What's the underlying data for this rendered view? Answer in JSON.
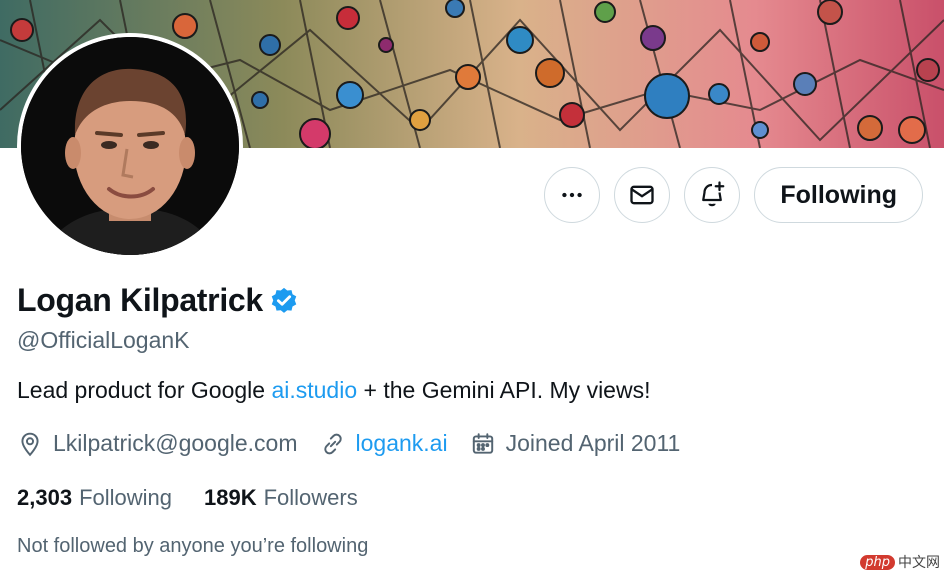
{
  "banner": {
    "description_icon": "stained-glass-banner"
  },
  "profile": {
    "name": "Logan Kilpatrick",
    "handle": "@OfficialLoganK",
    "verified": true,
    "bio": {
      "before": "Lead product for Google ",
      "link": "ai.studio",
      "after": " + the Gemini API. My views!"
    },
    "location": "Lkilpatrick@google.com",
    "website": "logank.ai",
    "joined": "Joined April 2011",
    "stats": {
      "following_count": "2,303",
      "following_label": "Following",
      "followers_count": "189K",
      "followers_label": "Followers"
    },
    "followed_by_note": "Not followed by anyone you’re following"
  },
  "actions": {
    "more_icon": "more-icon",
    "message_icon": "mail-icon",
    "notify_icon": "bell-plus-icon",
    "follow_label": "Following"
  },
  "watermark": {
    "badge": "php",
    "text": "中文网"
  },
  "colors": {
    "link": "#1d9bf0",
    "verified": "#1d9bf0",
    "muted": "#536471",
    "text": "#0f1419"
  }
}
